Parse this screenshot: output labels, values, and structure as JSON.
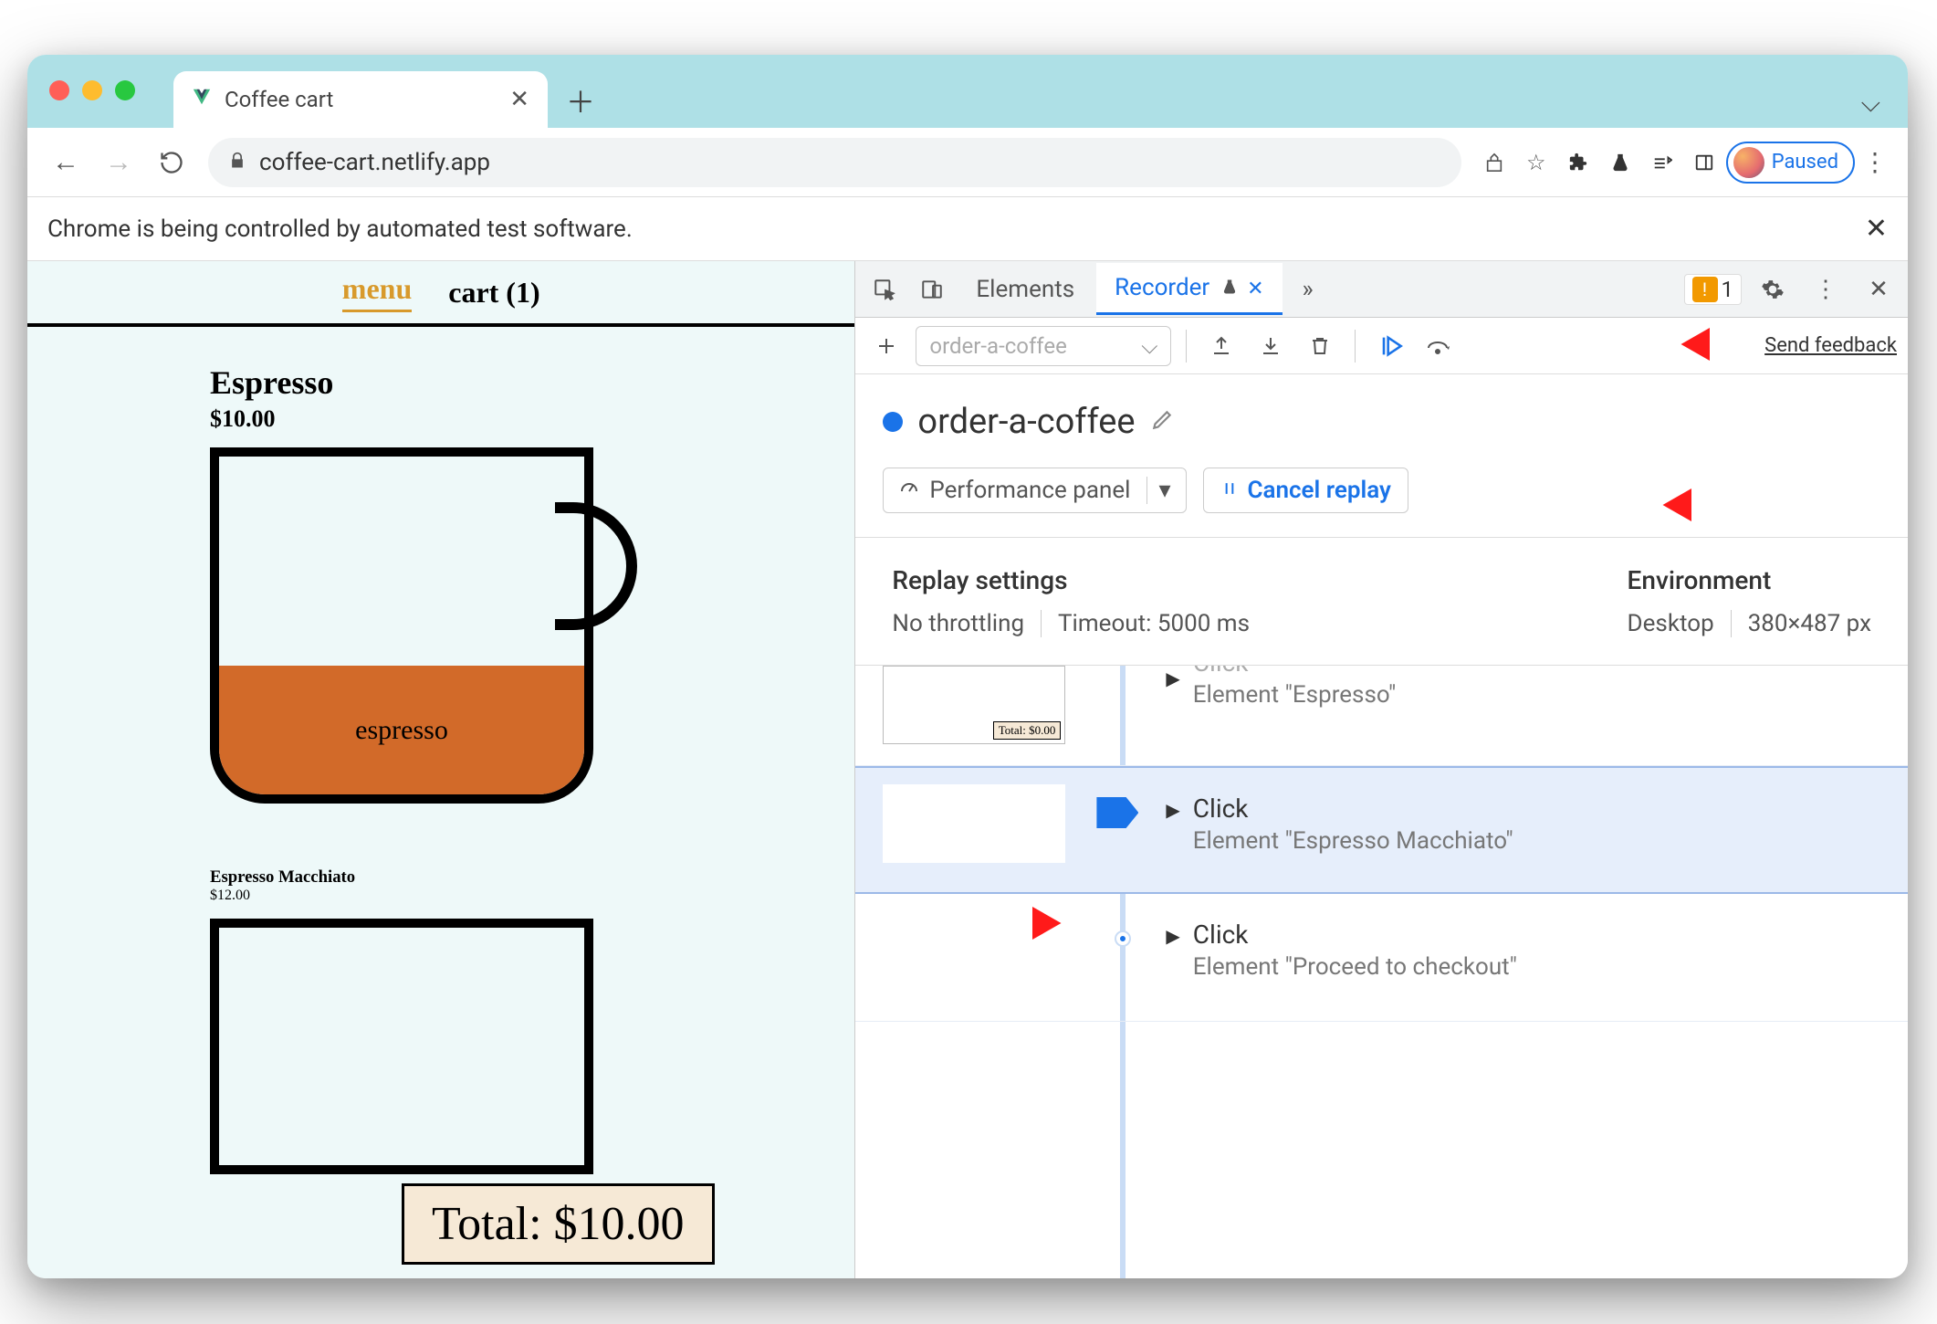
{
  "browser": {
    "tab_title": "Coffee cart",
    "url": "coffee-cart.netlify.app",
    "paused_label": "Paused",
    "infobar": "Chrome is being controlled by automated test software."
  },
  "page": {
    "nav": {
      "menu": "menu",
      "cart": "cart (1)"
    },
    "products": [
      {
        "name": "Espresso",
        "price": "$10.00",
        "fill_label": "espresso"
      },
      {
        "name": "Espresso Macchiato",
        "price": "$12.00"
      }
    ],
    "total": "Total: $10.00",
    "mini_total": "Total: $0.00"
  },
  "devtools": {
    "tabs": {
      "elements": "Elements",
      "recorder": "Recorder"
    },
    "issues_count": "1",
    "recording_placeholder": "order-a-coffee",
    "send_feedback": "Send feedback",
    "recording_title": "order-a-coffee",
    "perf_panel": "Performance panel",
    "cancel_replay": "Cancel replay",
    "settings": {
      "replay_heading": "Replay settings",
      "throttling": "No throttling",
      "timeout": "Timeout: 5000 ms",
      "env_heading": "Environment",
      "device": "Desktop",
      "viewport": "380×487 px"
    },
    "steps": [
      {
        "label": "Click",
        "element": "Element \"Espresso\""
      },
      {
        "label": "Click",
        "element": "Element \"Espresso Macchiato\""
      },
      {
        "label": "Click",
        "element": "Element \"Proceed to checkout\""
      }
    ]
  }
}
